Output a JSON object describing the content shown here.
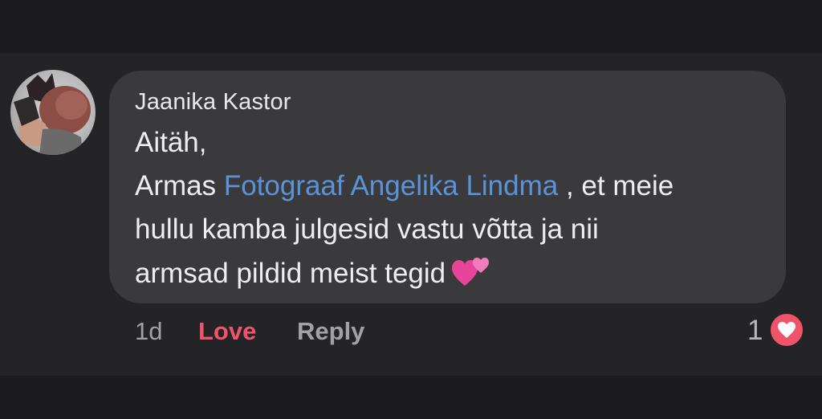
{
  "comment": {
    "author": "Jaanika Kastor",
    "text": {
      "line1": "Aitäh,",
      "line2_before": "Armas ",
      "mention": "Fotograaf Angelika Lindma",
      "line2_after": " , et meie",
      "line3": "hullu kamba julgesid vastu võtta ja nii",
      "line4": "armsad pildid meist tegid"
    },
    "emoji": "two-hearts-icon"
  },
  "actions": {
    "time": "1d",
    "love_label": "Love",
    "reply_label": "Reply"
  },
  "reactions": {
    "count": "1",
    "icon": "heart-reaction-icon",
    "color": "#f0546a"
  },
  "colors": {
    "background": "#242426",
    "bubble": "#3a3a3c",
    "mention": "#5b93d9",
    "love": "#f0546a"
  }
}
